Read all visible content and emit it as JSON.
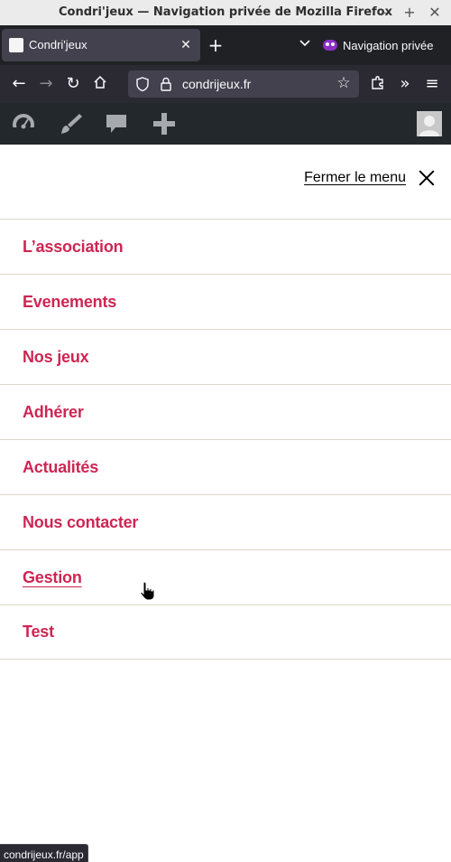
{
  "window": {
    "title": "Condri'jeux — Navigation privée de Mozilla Firefox"
  },
  "tabs": [
    {
      "label": "Condri'jeux",
      "active": true
    }
  ],
  "private_browsing": {
    "label": "Navigation privée",
    "color": "#8e2ec9"
  },
  "navbar": {
    "url": "condrijeux.fr"
  },
  "wp_admin_bar": {
    "icons": [
      "dashboard-icon",
      "customize-brush-icon",
      "comments-icon",
      "new-content-plus-icon"
    ]
  },
  "menu": {
    "close_label": "Fermer le menu",
    "items": [
      {
        "label": "L’association"
      },
      {
        "label": "Evenements"
      },
      {
        "label": "Nos jeux"
      },
      {
        "label": "Adhérer"
      },
      {
        "label": "Actualités"
      },
      {
        "label": "Nous contacter"
      },
      {
        "label": "Gestion",
        "hovered": true
      },
      {
        "label": "Test"
      }
    ],
    "link_color": "#cd2653"
  },
  "status_bar": {
    "text": "condrijeux.fr/app"
  }
}
